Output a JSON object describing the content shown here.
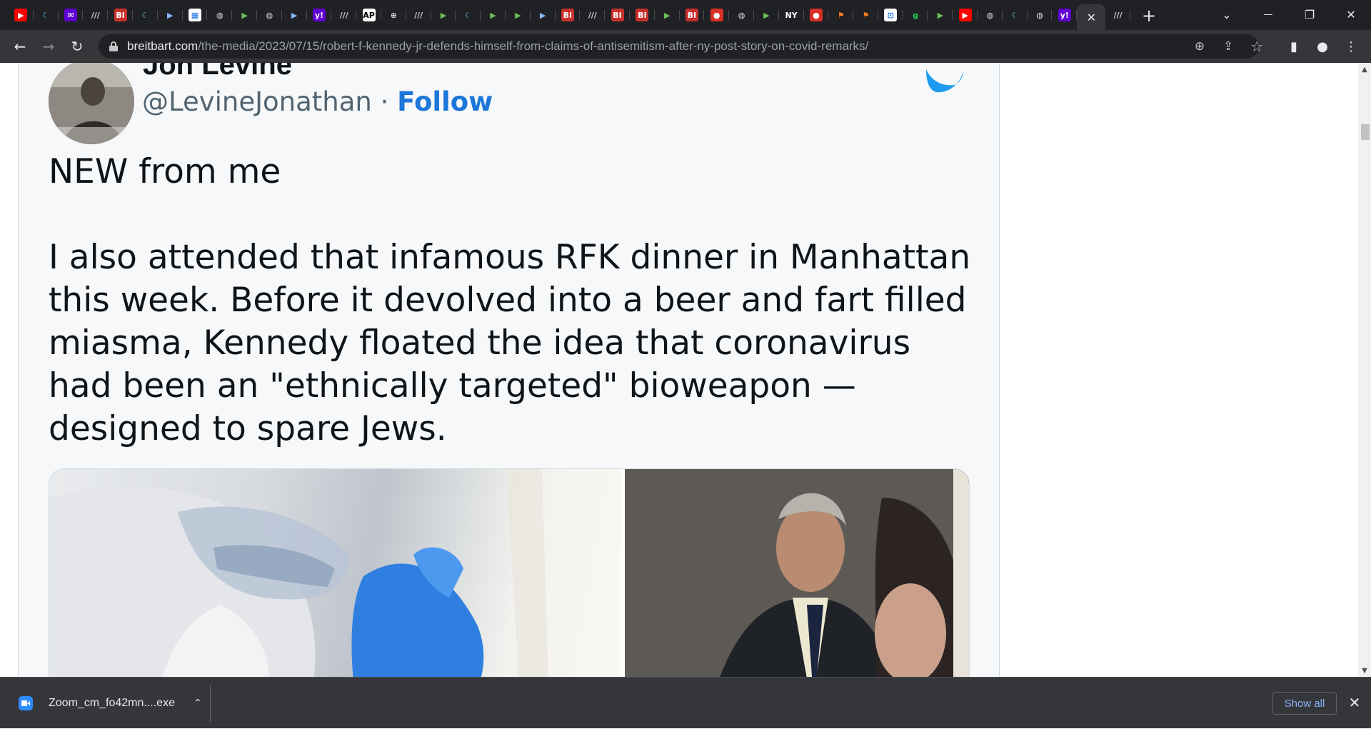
{
  "browser": {
    "tabs": [
      {
        "icon": "youtube-icon",
        "glyph": "▶",
        "bg": "#ff0000",
        "fg": "#ffffff"
      },
      {
        "icon": "tab-generic-icon",
        "glyph": "☾",
        "bg": "#202124",
        "fg": "#5aa7d6"
      },
      {
        "icon": "mail-icon",
        "glyph": "✉",
        "bg": "#6001d2",
        "fg": "#ffffff"
      },
      {
        "icon": "tab-generic-icon",
        "glyph": "///",
        "bg": "#202124",
        "fg": "#d0d0d0"
      },
      {
        "icon": "bi-icon",
        "glyph": "BI",
        "bg": "#c9302c",
        "fg": "#ffffff"
      },
      {
        "icon": "tab-generic-icon",
        "glyph": "☾",
        "bg": "#202124",
        "fg": "#5aa7d6"
      },
      {
        "icon": "tab-generic-icon",
        "glyph": "▶",
        "bg": "#202124",
        "fg": "#8ab4f8"
      },
      {
        "icon": "tab-generic-icon",
        "glyph": "▦",
        "bg": "#ffffff",
        "fg": "#1a73e8"
      },
      {
        "icon": "globe-icon",
        "glyph": "◍",
        "bg": "#202124",
        "fg": "#dadce0"
      },
      {
        "icon": "play-icon",
        "glyph": "▶",
        "bg": "#202124",
        "fg": "#6ac259"
      },
      {
        "icon": "globe-icon",
        "glyph": "◍",
        "bg": "#202124",
        "fg": "#dadce0"
      },
      {
        "icon": "tab-generic-icon",
        "glyph": "▶",
        "bg": "#202124",
        "fg": "#8ab4f8"
      },
      {
        "icon": "yahoo-icon",
        "glyph": "y!",
        "bg": "#6001d2",
        "fg": "#ffffff"
      },
      {
        "icon": "tab-generic-icon",
        "glyph": "///",
        "bg": "#202124",
        "fg": "#d0d0d0"
      },
      {
        "icon": "ap-icon",
        "glyph": "AP",
        "bg": "#ffffff",
        "fg": "#000000"
      },
      {
        "icon": "globe-icon",
        "glyph": "⊕",
        "bg": "#202124",
        "fg": "#dadce0"
      },
      {
        "icon": "tab-generic-icon",
        "glyph": "///",
        "bg": "#202124",
        "fg": "#d0d0d0"
      },
      {
        "icon": "play-icon",
        "glyph": "▶",
        "bg": "#202124",
        "fg": "#6ac259"
      },
      {
        "icon": "tab-generic-icon",
        "glyph": "☾",
        "bg": "#202124",
        "fg": "#5aa7d6"
      },
      {
        "icon": "play-icon",
        "glyph": "▶",
        "bg": "#202124",
        "fg": "#6ac259"
      },
      {
        "icon": "play-icon",
        "glyph": "▶",
        "bg": "#202124",
        "fg": "#6ac259"
      },
      {
        "icon": "tab-generic-icon",
        "glyph": "▶",
        "bg": "#202124",
        "fg": "#8ab4f8"
      },
      {
        "icon": "bi-icon",
        "glyph": "BI",
        "bg": "#c9302c",
        "fg": "#ffffff"
      },
      {
        "icon": "tab-generic-icon",
        "glyph": "///",
        "bg": "#202124",
        "fg": "#d0d0d0"
      },
      {
        "icon": "bi-icon",
        "glyph": "BI",
        "bg": "#c9302c",
        "fg": "#ffffff"
      },
      {
        "icon": "bi-icon",
        "glyph": "BI",
        "bg": "#c9302c",
        "fg": "#ffffff"
      },
      {
        "icon": "play-icon",
        "glyph": "▶",
        "bg": "#202124",
        "fg": "#6ac259"
      },
      {
        "icon": "bi-icon",
        "glyph": "BI",
        "bg": "#c9302c",
        "fg": "#ffffff"
      },
      {
        "icon": "mic-icon",
        "glyph": "●",
        "bg": "#d93025",
        "fg": "#ffffff"
      },
      {
        "icon": "globe-icon",
        "glyph": "◍",
        "bg": "#202124",
        "fg": "#dadce0"
      },
      {
        "icon": "play-icon",
        "glyph": "▶",
        "bg": "#202124",
        "fg": "#6ac259"
      },
      {
        "icon": "tab-generic-icon",
        "glyph": "NY",
        "bg": "#202124",
        "fg": "#ffffff"
      },
      {
        "icon": "mic-icon",
        "glyph": "●",
        "bg": "#d93025",
        "fg": "#ffffff"
      },
      {
        "icon": "bookmark-icon",
        "glyph": "⚑",
        "bg": "#202124",
        "fg": "#ff7a1a"
      },
      {
        "icon": "bookmark-icon",
        "glyph": "⚑",
        "bg": "#202124",
        "fg": "#ff7a1a"
      },
      {
        "icon": "lock-icon",
        "glyph": "⊡",
        "bg": "#ffffff",
        "fg": "#1a73e8"
      },
      {
        "icon": "g-icon",
        "glyph": "g",
        "bg": "#202124",
        "fg": "#1fd15a"
      },
      {
        "icon": "play-icon",
        "glyph": "▶",
        "bg": "#202124",
        "fg": "#6ac259"
      },
      {
        "icon": "youtube-icon",
        "glyph": "▶",
        "bg": "#ff0000",
        "fg": "#ffffff"
      },
      {
        "icon": "globe-icon",
        "glyph": "◍",
        "bg": "#202124",
        "fg": "#dadce0"
      },
      {
        "icon": "tab-generic-icon",
        "glyph": "☾",
        "bg": "#202124",
        "fg": "#5aa7d6"
      },
      {
        "icon": "globe-icon",
        "glyph": "◍",
        "bg": "#202124",
        "fg": "#dadce0"
      },
      {
        "icon": "yahoo-icon",
        "glyph": "y!",
        "bg": "#6001d2",
        "fg": "#ffffff"
      }
    ],
    "active_tab": {
      "close_glyph": "✕"
    },
    "trailing_tab": {
      "glyph": "///"
    },
    "new_tab_glyph": "+",
    "tab_search_glyph": "⌄",
    "minimize_glyph": "—",
    "restore_glyph": "❐",
    "close_glyph": "✕",
    "back_glyph": "←",
    "forward_glyph": "→",
    "reload_glyph": "↻",
    "url_host": "breitbart.com",
    "url_path": "/the-media/2023/07/15/robert-f-kennedy-jr-defends-himself-from-claims-of-antisemitism-after-ny-post-story-on-covid-remarks/",
    "zoom_glyph": "⊕",
    "share_glyph": "⇪",
    "star_glyph": "☆",
    "sidepanel_glyph": "▮",
    "profile_glyph": "●",
    "menu_glyph": "⋮"
  },
  "tweet": {
    "author_name": "Jon Levine",
    "handle": "@LevineJonathan",
    "separator": " · ",
    "follow_label": "Follow",
    "bird_color": "#1d9bf0",
    "text_line_1": "NEW from me",
    "text_paragraph_2": "I also attended that infamous RFK dinner in Manhattan this week. Before it devolved into a beer and fart filled miasma, Kennedy floated the idea that coronavirus had been an \"ethnically targeted\" bioweapon — designed to spare Jews."
  },
  "scrollbar": {
    "up_glyph": "▲",
    "down_glyph": "▼"
  },
  "downloads": {
    "file_name": "Zoom_cm_fo42mn....exe",
    "chevron_glyph": "⌃",
    "show_all_label": "Show all",
    "close_glyph": "✕"
  }
}
